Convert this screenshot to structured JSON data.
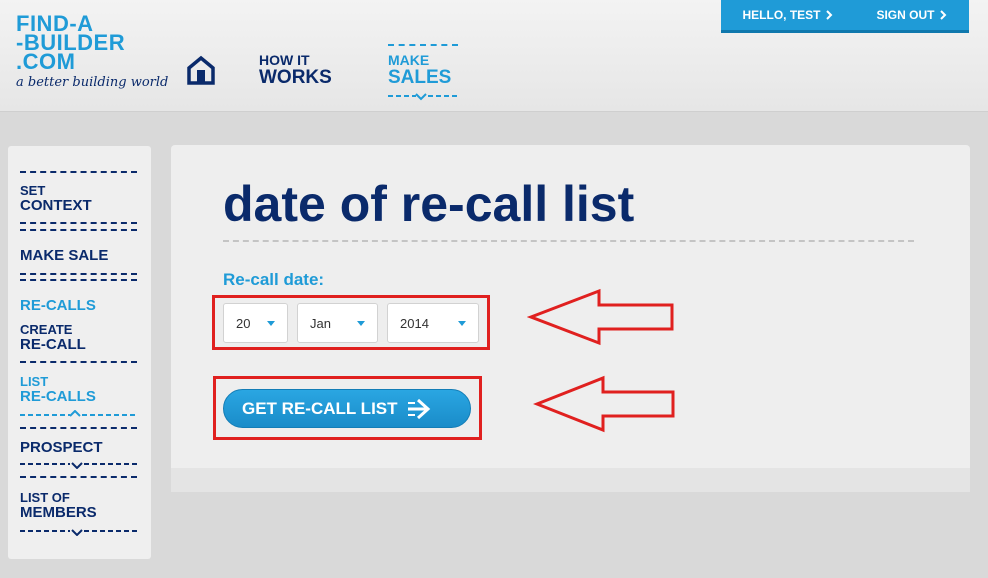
{
  "header": {
    "logo_lines": [
      "FIND-A",
      "-BUILDER",
      ".COM"
    ],
    "tagline": "a better building world",
    "nav": [
      {
        "small": "HOW IT",
        "big": "WORKS"
      },
      {
        "small": "MAKE",
        "big": "SALES"
      }
    ],
    "user": {
      "greeting": "HELLO, TEST",
      "signout": "SIGN OUT"
    }
  },
  "sidebar": {
    "items": [
      {
        "small": "SET",
        "big": "CONTEXT"
      },
      {
        "small": "",
        "big": "MAKE SALE"
      },
      {
        "small": "",
        "big": "RE-CALLS"
      },
      {
        "small": "CREATE",
        "big": "RE-CALL"
      },
      {
        "small": "LIST",
        "big": "RE-CALLS"
      },
      {
        "small": "",
        "big": "PROSPECT"
      },
      {
        "small": "LIST OF",
        "big": "MEMBERS"
      }
    ]
  },
  "main": {
    "title": "date of re-call list",
    "label": "Re-call date:",
    "selects": {
      "day": "20",
      "month": "Jan",
      "year": "2014"
    },
    "button": "GET RE-CALL LIST"
  },
  "colors": {
    "brand_blue": "#1f9bd7",
    "navy": "#0a2a6b",
    "annotation_red": "#e0201f"
  }
}
